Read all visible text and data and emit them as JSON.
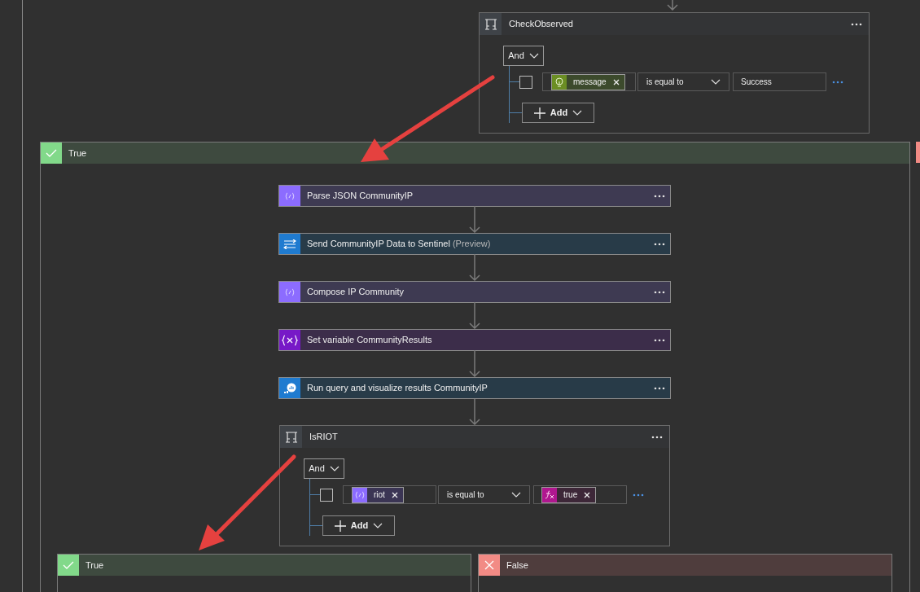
{
  "condition": {
    "title": "CheckObserved",
    "operator": "And",
    "rows": [
      {
        "checked": false,
        "left_token": {
          "kind": "dynamic",
          "label": "message"
        },
        "comparison": "is equal to",
        "right_value": "Success"
      }
    ],
    "add_label": "Add"
  },
  "true_branch": {
    "label": "True",
    "actions": [
      {
        "kind": "parse",
        "title": "Parse JSON CommunityIP"
      },
      {
        "kind": "connector",
        "title": "Send CommunityIP Data to Sentinel",
        "badge": "(Preview)"
      },
      {
        "kind": "parse",
        "title": "Compose IP Community"
      },
      {
        "kind": "variable",
        "title": "Set variable CommunityResults"
      },
      {
        "kind": "query",
        "title": "Run query and visualize results CommunityIP"
      }
    ],
    "nested_condition": {
      "title": "IsRIOT",
      "operator": "And",
      "rows": [
        {
          "checked": false,
          "left_token": {
            "kind": "variable",
            "label": "riot"
          },
          "comparison": "is equal to",
          "right_token": {
            "kind": "expression",
            "label": "true"
          }
        }
      ],
      "add_label": "Add"
    },
    "nested_branches": [
      {
        "kind": "true",
        "label": "True"
      },
      {
        "kind": "false",
        "label": "False"
      }
    ]
  }
}
